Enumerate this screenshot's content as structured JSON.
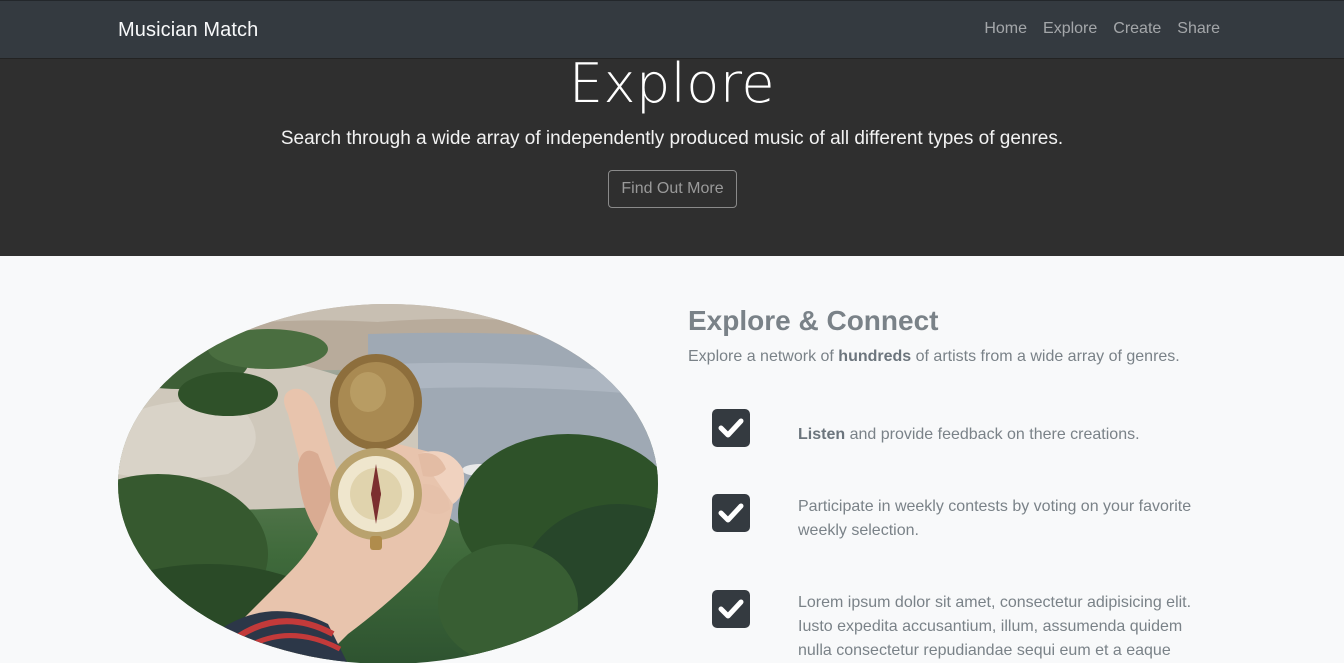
{
  "navbar": {
    "brand": "Musician Match",
    "links": [
      "Home",
      "Explore",
      "Create",
      "Share"
    ]
  },
  "hero": {
    "title": "Explore",
    "subtitle": "Search through a wide array of independently produced music of all different types of genres.",
    "button_label": "Find Out More"
  },
  "section": {
    "title": "Explore & Connect",
    "intro_before": "Explore a network of ",
    "intro_bold": "hundreds",
    "intro_after": " of artists from a wide array of genres."
  },
  "features": [
    {
      "bold": "Listen",
      "text": " and provide feedback on there creations."
    },
    {
      "bold": "",
      "text": "Participate in weekly contests by voting on your favorite weekly selection."
    },
    {
      "bold": "",
      "text": "Lorem ipsum dolor sit amet, consectetur adipisicing elit. Iusto expedita accusantium, illum, assumenda quidem nulla consectetur repudiandae sequi eum et a eaque"
    }
  ],
  "icons": {
    "checkbox": "check-square-icon",
    "image": "compass-in-hand-photo"
  },
  "colors": {
    "navbar": "#343a40",
    "hero": "#2f2f2f",
    "page": "#f8f9fa",
    "muted_text": "#7a8288"
  }
}
